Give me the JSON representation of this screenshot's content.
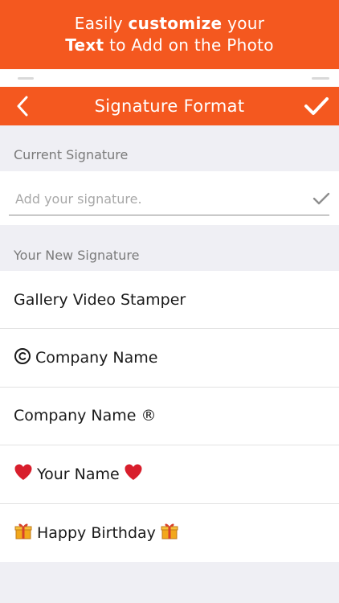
{
  "promo": {
    "line1_pre": "Easily ",
    "line1_bold": "customize",
    "line1_post": " your",
    "line2_bold": "Text",
    "line2_post": " to Add on the Photo"
  },
  "navbar": {
    "title": "Signature Format"
  },
  "current": {
    "header": "Current Signature",
    "placeholder": "Add your signature."
  },
  "new": {
    "header": "Your New Signature",
    "items": [
      {
        "text": "Gallery Video Stamper"
      },
      {
        "prefix": "©",
        "text": "Company Name"
      },
      {
        "text": "Company Name ®"
      },
      {
        "text": "Your Name"
      },
      {
        "text": "Happy Birthday"
      }
    ]
  },
  "colors": {
    "accent": "#f4581f",
    "background": "#efeff4",
    "heart": "#d81e2c",
    "gift": "#f2a81b"
  },
  "icons": {
    "back": "chevron-left-icon",
    "done": "checkmark-icon",
    "input_check": "checkmark-icon",
    "heart": "heart-icon",
    "gift": "gift-icon",
    "copyright": "copyright-icon"
  }
}
